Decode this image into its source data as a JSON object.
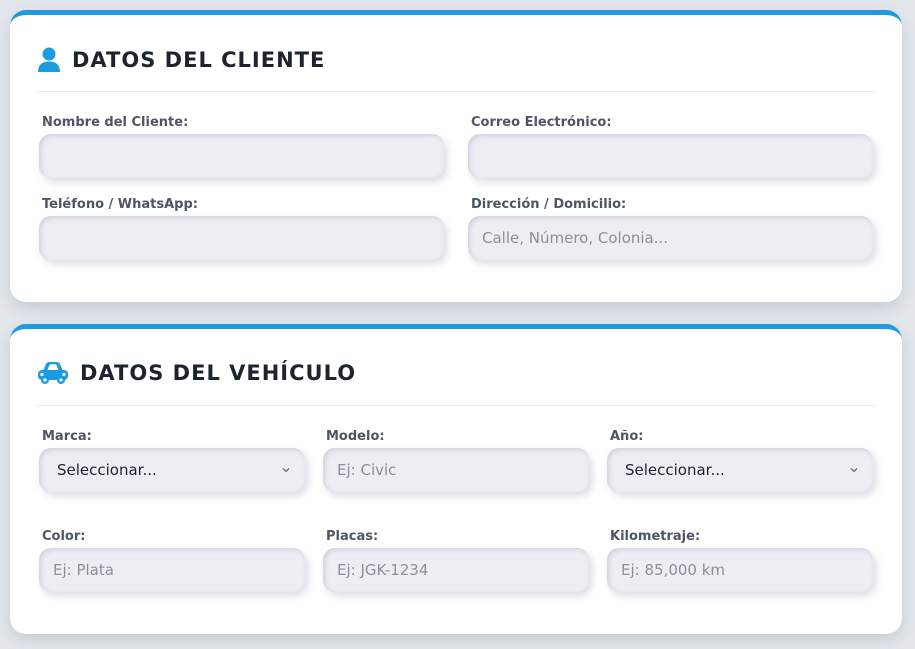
{
  "client_section": {
    "title": "DATOS DEL CLIENTE",
    "icon": "user-icon",
    "fields": {
      "name": {
        "label": "Nombre del Cliente:",
        "placeholder": ""
      },
      "email": {
        "label": "Correo Electrónico:",
        "placeholder": ""
      },
      "phone": {
        "label": "Teléfono / WhatsApp:",
        "placeholder": ""
      },
      "address": {
        "label": "Dirección / Domicilio:",
        "placeholder": "Calle, Número, Colonia..."
      }
    }
  },
  "vehicle_section": {
    "title": "DATOS DEL VEHÍCULO",
    "icon": "car-icon",
    "fields": {
      "brand": {
        "label": "Marca:",
        "value": "Seleccionar..."
      },
      "model": {
        "label": "Modelo:",
        "placeholder": "Ej: Civic"
      },
      "year": {
        "label": "Año:",
        "value": "Seleccionar..."
      },
      "color": {
        "label": "Color:",
        "placeholder": "Ej: Plata"
      },
      "plates": {
        "label": "Placas:",
        "placeholder": "Ej: JGK-1234"
      },
      "mileage": {
        "label": "Kilometraje:",
        "placeholder": "Ej: 85,000 km"
      }
    }
  },
  "colors": {
    "accent": "#1e9be0",
    "title": "#1d2430",
    "label": "#4f5663",
    "background": "#e3e7ec"
  }
}
